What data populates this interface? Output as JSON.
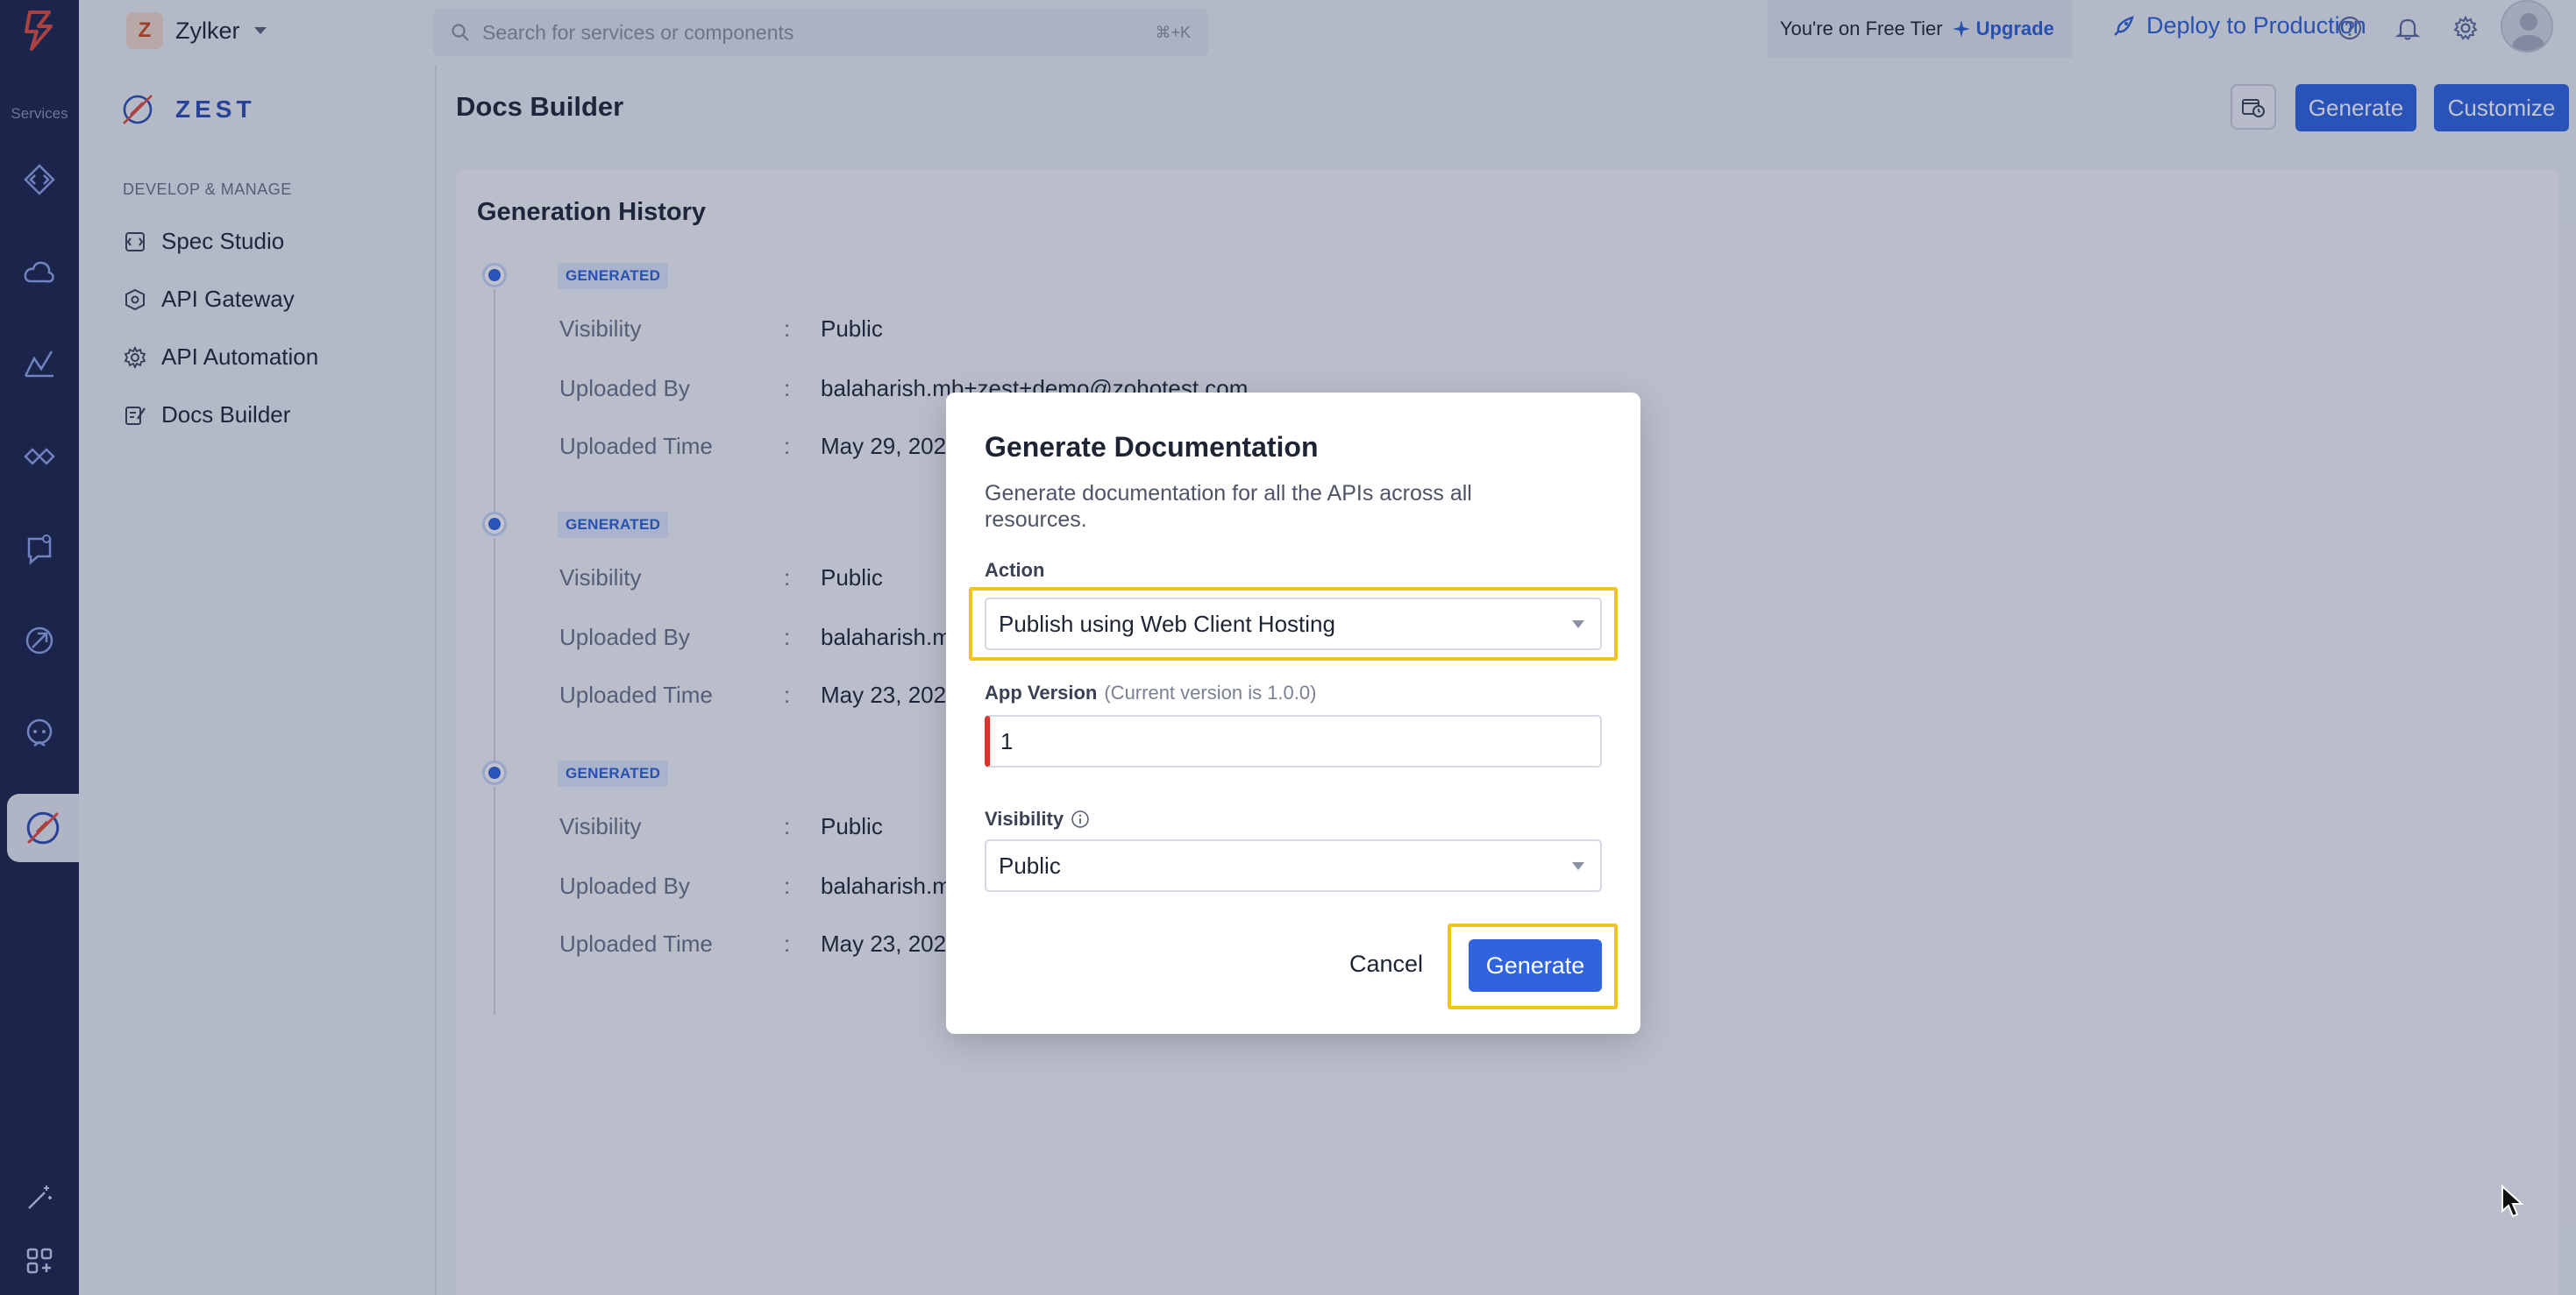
{
  "rail": {
    "services_label": "Services",
    "items": [
      "code-icon",
      "cloud-icon",
      "chart-icon",
      "api-icon",
      "bot-icon",
      "rocket-icon",
      "monitor-icon",
      "zest-icon"
    ],
    "bottom": [
      "magic-wand-icon",
      "apps-grid-icon"
    ]
  },
  "topbar": {
    "org_initial": "Z",
    "org_name": "Zylker",
    "search_placeholder": "Search for services or components",
    "search_shortcut": "⌘+K",
    "tier_text": "You're on Free Tier",
    "upgrade_label": "Upgrade",
    "deploy_label": "Deploy to Production"
  },
  "sidebar": {
    "brand": "ZEST",
    "section": "DEVELOP & MANAGE",
    "items": [
      {
        "label": "Spec Studio"
      },
      {
        "label": "API Gateway"
      },
      {
        "label": "API Automation"
      },
      {
        "label": "Docs Builder"
      }
    ]
  },
  "header": {
    "title": "Docs Builder",
    "generate_label": "Generate",
    "customize_label": "Customize"
  },
  "history": {
    "title": "Generation History",
    "entries": [
      {
        "status": "GENERATED",
        "visibility_label": "Visibility",
        "visibility": "Public",
        "uploaded_by_label": "Uploaded By",
        "uploaded_by": "balaharish.mb+zest+demo@zohotest.com",
        "uploaded_time_label": "Uploaded Time",
        "uploaded_time": "May 29, 202"
      },
      {
        "status": "GENERATED",
        "visibility_label": "Visibility",
        "visibility": "Public",
        "uploaded_by_label": "Uploaded By",
        "uploaded_by": "balaharish.m",
        "uploaded_time_label": "Uploaded Time",
        "uploaded_time": "May 23, 202"
      },
      {
        "status": "GENERATED",
        "visibility_label": "Visibility",
        "visibility": "Public",
        "uploaded_by_label": "Uploaded By",
        "uploaded_by": "balaharish.m",
        "uploaded_time_label": "Uploaded Time",
        "uploaded_time": "May 23, 202"
      }
    ],
    "separator": ":"
  },
  "modal": {
    "title": "Generate Documentation",
    "description": "Generate documentation for all the APIs across all resources.",
    "action_label": "Action",
    "action_value": "Publish using Web Client Hosting",
    "version_label": "App Version",
    "version_hint": "(Current version is 1.0.0)",
    "version_value": "1",
    "visibility_label": "Visibility",
    "visibility_value": "Public",
    "cancel_label": "Cancel",
    "generate_label": "Generate"
  },
  "colors": {
    "primary": "#2f63e0",
    "rail": "#1a2248",
    "highlight": "#f0c419",
    "error": "#d8342c"
  }
}
